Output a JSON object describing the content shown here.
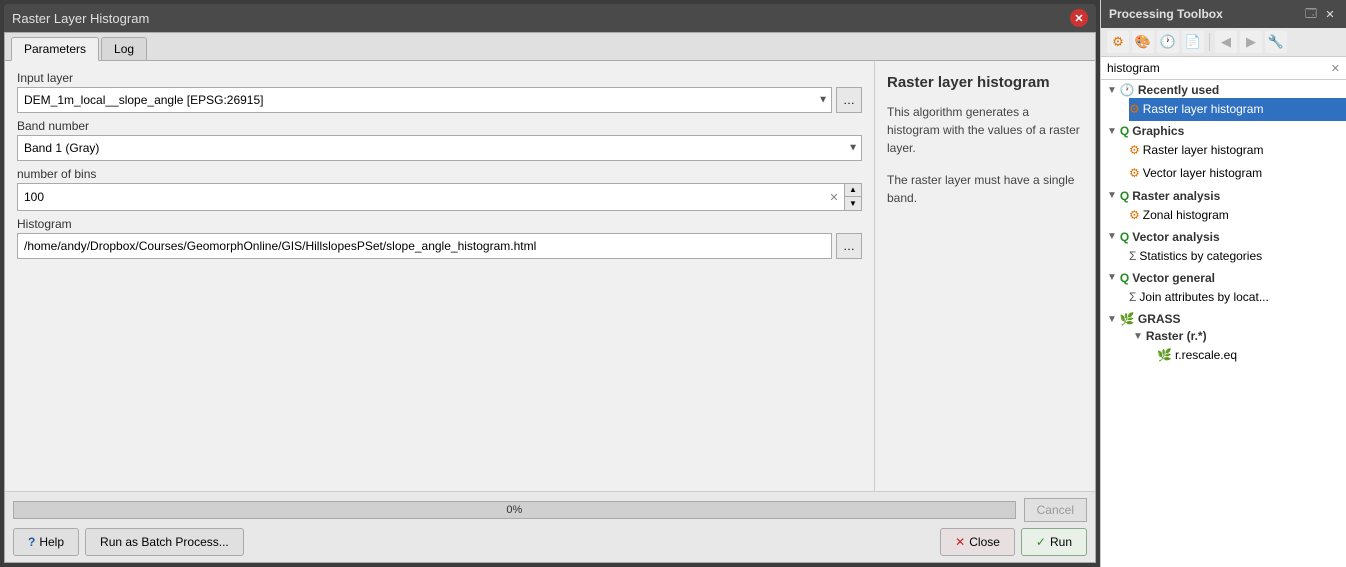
{
  "dialog": {
    "title": "Raster Layer Histogram",
    "tabs": [
      "Parameters",
      "Log"
    ],
    "active_tab": "Parameters"
  },
  "form": {
    "input_layer_label": "Input layer",
    "input_layer_value": "DEM_1m_local__slope_angle [EPSG:26915]",
    "band_number_label": "Band number",
    "band_number_value": "Band 1 (Gray)",
    "bins_label": "number of bins",
    "bins_value": "100",
    "histogram_label": "Histogram",
    "histogram_path": "/home/andy/Dropbox/Courses/GeomorphOnline/GIS/HillslopesPSet/slope_angle_histogram.html"
  },
  "description": {
    "title": "Raster layer histogram",
    "paragraph1": "This algorithm generates a histogram with the values of a raster layer.",
    "paragraph2": "The raster layer must have a single band."
  },
  "progress": {
    "label": "0%",
    "value": 0
  },
  "buttons": {
    "help": "?Help",
    "batch": "Run as Batch Process...",
    "cancel": "Cancel",
    "close": "Close",
    "run": "Run"
  },
  "toolbox": {
    "title": "Processing Toolbox",
    "search_placeholder": "histogram",
    "toolbar_icons": [
      "gear",
      "palette",
      "clock",
      "document",
      "arrow-left",
      "arrow-right",
      "wrench"
    ],
    "tree": [
      {
        "id": "recently-used",
        "label": "Recently used",
        "icon": "clock",
        "children": [
          {
            "id": "raster-layer-histogram-recent",
            "label": "Raster layer histogram",
            "icon": "gear",
            "selected": true
          }
        ]
      },
      {
        "id": "graphics",
        "label": "Graphics",
        "icon": "q",
        "children": [
          {
            "id": "raster-layer-histogram-graphics",
            "label": "Raster layer histogram",
            "icon": "gear"
          },
          {
            "id": "vector-layer-histogram",
            "label": "Vector layer histogram",
            "icon": "gear"
          }
        ]
      },
      {
        "id": "raster-analysis",
        "label": "Raster analysis",
        "icon": "q",
        "children": [
          {
            "id": "zonal-histogram",
            "label": "Zonal histogram",
            "icon": "gear"
          }
        ]
      },
      {
        "id": "vector-analysis",
        "label": "Vector analysis",
        "icon": "q",
        "children": [
          {
            "id": "statistics-by-categories",
            "label": "Statistics by categories",
            "icon": "sigma"
          }
        ]
      },
      {
        "id": "vector-general",
        "label": "Vector general",
        "icon": "q",
        "children": [
          {
            "id": "join-attributes-by-locat",
            "label": "Join attributes by locat...",
            "icon": "sigma"
          }
        ]
      },
      {
        "id": "grass",
        "label": "GRASS",
        "icon": "grass",
        "children": [
          {
            "id": "raster-r",
            "label": "Raster (r.*)",
            "icon": "folder",
            "children": [
              {
                "id": "r-rescale-eq",
                "label": "r.rescale.eq",
                "icon": "grass-leaf"
              }
            ]
          }
        ]
      }
    ]
  }
}
